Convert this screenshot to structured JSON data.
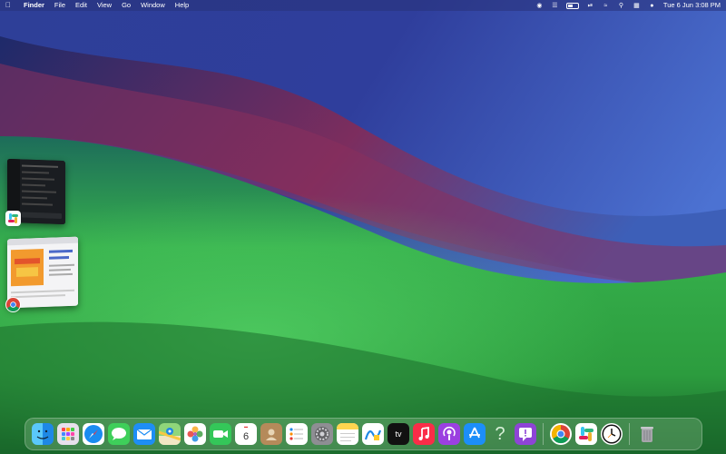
{
  "menubar": {
    "app_name": "Finder",
    "menus": [
      "File",
      "Edit",
      "View",
      "Go",
      "Window",
      "Help"
    ],
    "clock": "Tue 6 Jun 3:08 PM"
  },
  "stage_manager": [
    {
      "app": "Slack"
    },
    {
      "app": "Google Chrome"
    }
  ],
  "dock": {
    "items": [
      {
        "name": "Finder",
        "icon": "finder-icon",
        "running": true
      },
      {
        "name": "Launchpad",
        "icon": "launchpad-icon",
        "running": false
      },
      {
        "name": "Safari",
        "icon": "safari-icon",
        "running": false
      },
      {
        "name": "Messages",
        "icon": "messages-icon",
        "running": false
      },
      {
        "name": "Mail",
        "icon": "mail-icon",
        "running": false
      },
      {
        "name": "Maps",
        "icon": "maps-icon",
        "running": false
      },
      {
        "name": "Photos",
        "icon": "photos-icon",
        "running": false
      },
      {
        "name": "FaceTime",
        "icon": "facetime-icon",
        "running": false
      },
      {
        "name": "Calendar",
        "icon": "calendar-icon",
        "running": false,
        "day": "6"
      },
      {
        "name": "Contacts",
        "icon": "contacts-icon",
        "running": false
      },
      {
        "name": "Reminders",
        "icon": "reminders-icon",
        "running": false
      },
      {
        "name": "System Settings",
        "icon": "settings-icon",
        "running": false
      },
      {
        "name": "Notes",
        "icon": "notes-icon",
        "running": true
      },
      {
        "name": "Freeform",
        "icon": "freeform-icon",
        "running": false
      },
      {
        "name": "Apple TV",
        "icon": "tv-icon",
        "running": true,
        "label": "tv"
      },
      {
        "name": "Music",
        "icon": "music-icon",
        "running": false
      },
      {
        "name": "Podcasts",
        "icon": "podcasts-icon",
        "running": false
      },
      {
        "name": "App Store",
        "icon": "appstore-icon",
        "running": false
      },
      {
        "name": "Tips",
        "icon": "tips-icon",
        "running": false
      },
      {
        "name": "Feedback Assistant",
        "icon": "feedback-icon",
        "running": false
      },
      {
        "name": "Google Chrome",
        "icon": "chrome-icon",
        "running": true
      },
      {
        "name": "Slack",
        "icon": "slack-icon",
        "running": true
      },
      {
        "name": "Clock",
        "icon": "clock-icon",
        "running": false
      },
      {
        "name": "Trash",
        "icon": "trash-icon",
        "running": false
      }
    ]
  },
  "colors": {
    "menubar_bg": "#28327a",
    "wallpaper_top": "#3a58b8",
    "wallpaper_mid": "#7a2f5e",
    "wallpaper_bottom": "#2fb54a"
  }
}
